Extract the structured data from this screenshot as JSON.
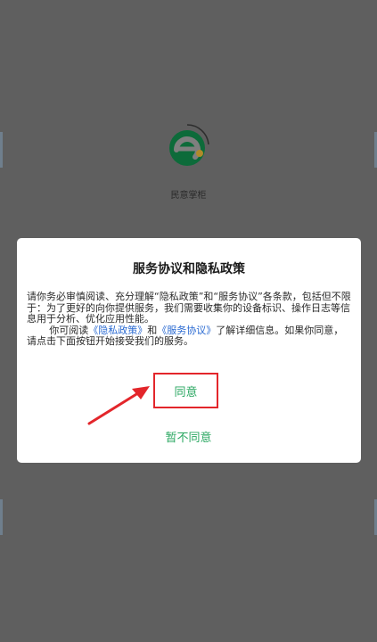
{
  "app": {
    "name": "民意掌柜"
  },
  "dialog": {
    "title": "服务协议和隐私政策",
    "paragraph1": "请你务必审慎阅读、充分理解“隐私政策”和“服务协议”各条款，包括但不限于：为了更好的向你提供服务，我们需要收集你的设备标识、操作日志等信息用于分析、优化应用性能。",
    "p2_prefix": "你可阅读",
    "privacy_link": "《隐私政策》",
    "p2_and": "和",
    "service_link": "《服务协议》",
    "p2_suffix": "了解详细信息。如果你同意，请点击下面按钮开始接受我们的服务。",
    "agree_label": "同意",
    "disagree_label": "暂不同意"
  },
  "colors": {
    "accent_green": "#2aa761",
    "link_blue": "#2a6ad2",
    "annotation_red": "#e3262b"
  }
}
